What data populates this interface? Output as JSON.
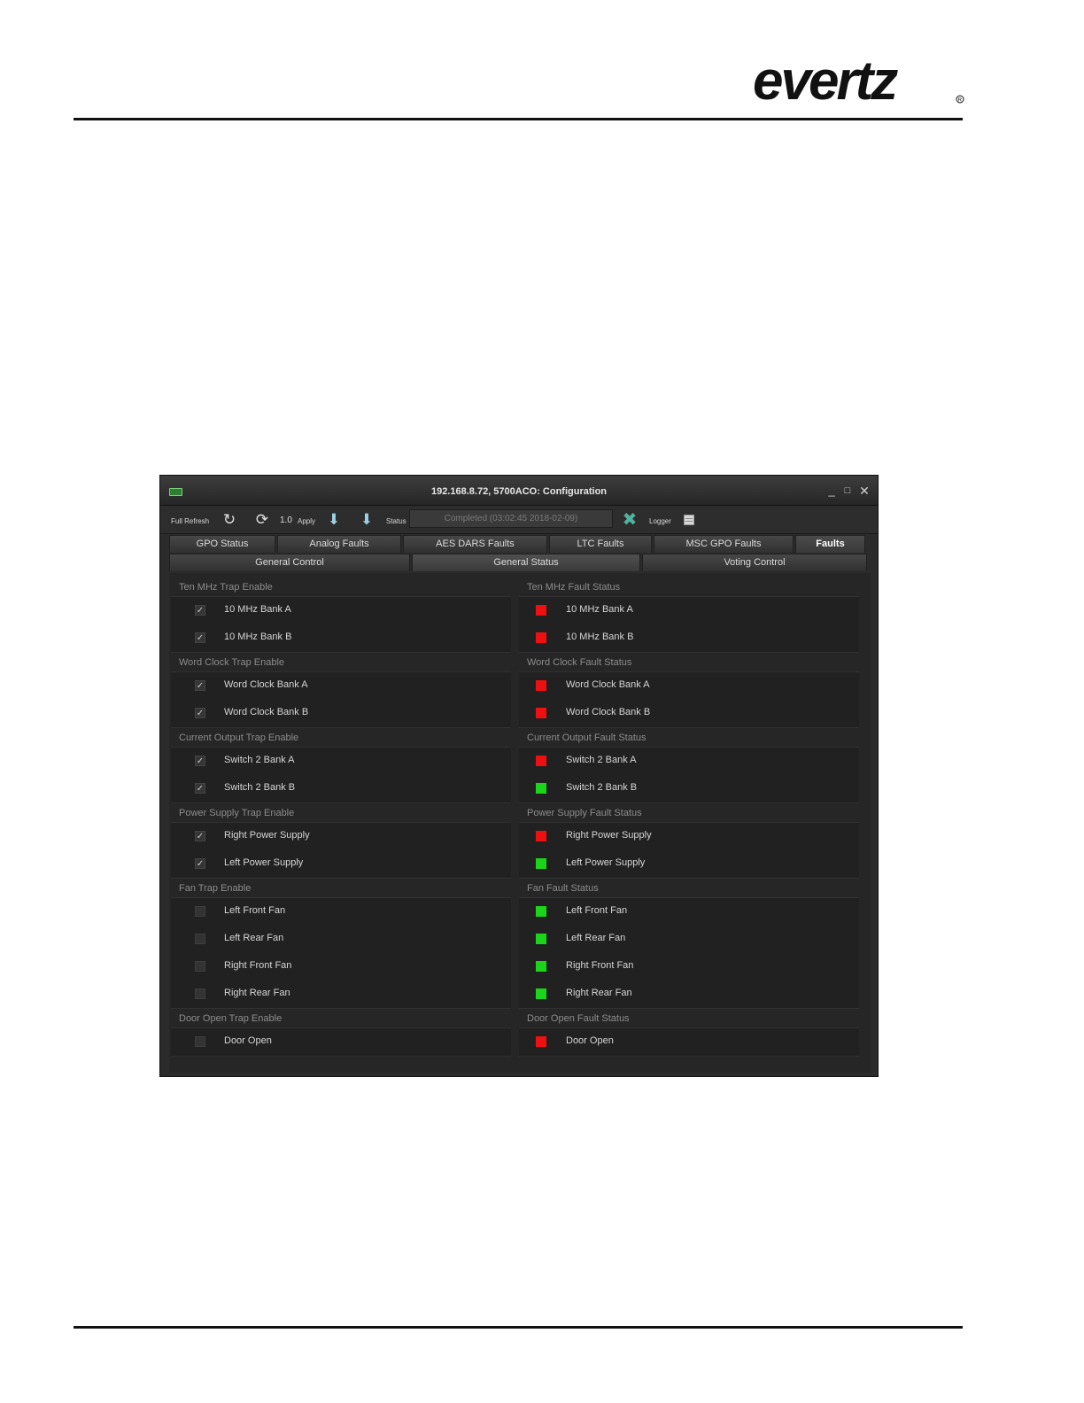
{
  "page": {
    "logo_text": "evertz"
  },
  "window": {
    "title": "192.168.8.72, 5700ACO: Configuration",
    "controls": {
      "minimize": "_",
      "maximize": "□",
      "close": "✕"
    }
  },
  "toolbar": {
    "full_refresh_label": "Full Refresh",
    "version": "1.0",
    "apply_label": "Apply",
    "status_label": "Status",
    "status_value": "Completed  (03:02:45 2018-02-09)",
    "logger_label": "Logger"
  },
  "tabs_main": [
    "GPO Status",
    "Analog Faults",
    "AES DARS Faults",
    "LTC Faults",
    "MSC GPO Faults",
    "Faults"
  ],
  "tabs_sub": [
    "General Control",
    "General Status",
    "Voting Control"
  ],
  "colors": {
    "led_red": "#ee1010",
    "led_green": "#1bd51b",
    "window_bg": "#2b2b2b"
  },
  "trap_groups": [
    {
      "title": "Ten MHz Trap Enable",
      "items": [
        {
          "label": "10 MHz Bank A",
          "checked": true
        },
        {
          "label": "10 MHz Bank B",
          "checked": true
        }
      ]
    },
    {
      "title": "Word Clock Trap Enable",
      "items": [
        {
          "label": "Word Clock Bank A",
          "checked": true
        },
        {
          "label": "Word Clock Bank B",
          "checked": true
        }
      ]
    },
    {
      "title": "Current Output Trap Enable",
      "items": [
        {
          "label": "Switch 2 Bank A",
          "checked": true
        },
        {
          "label": "Switch 2 Bank B",
          "checked": true
        }
      ]
    },
    {
      "title": "Power Supply Trap Enable",
      "items": [
        {
          "label": "Right Power Supply",
          "checked": true
        },
        {
          "label": "Left Power Supply",
          "checked": true
        }
      ]
    },
    {
      "title": "Fan Trap Enable",
      "items": [
        {
          "label": "Left Front Fan",
          "checked": false
        },
        {
          "label": "Left Rear Fan",
          "checked": false
        },
        {
          "label": "Right Front Fan",
          "checked": false
        },
        {
          "label": "Right Rear Fan",
          "checked": false
        }
      ]
    },
    {
      "title": "Door Open Trap Enable",
      "items": [
        {
          "label": "Door Open",
          "checked": false
        }
      ]
    }
  ],
  "status_groups": [
    {
      "title": "Ten MHz Fault Status",
      "items": [
        {
          "label": "10 MHz Bank A",
          "state": "red"
        },
        {
          "label": "10 MHz Bank B",
          "state": "red"
        }
      ]
    },
    {
      "title": "Word Clock Fault Status",
      "items": [
        {
          "label": "Word Clock Bank A",
          "state": "red"
        },
        {
          "label": "Word Clock Bank B",
          "state": "red"
        }
      ]
    },
    {
      "title": "Current Output Fault Status",
      "items": [
        {
          "label": "Switch 2 Bank A",
          "state": "red"
        },
        {
          "label": "Switch 2 Bank B",
          "state": "green"
        }
      ]
    },
    {
      "title": "Power Supply Fault Status",
      "items": [
        {
          "label": "Right Power Supply",
          "state": "red"
        },
        {
          "label": "Left Power Supply",
          "state": "green"
        }
      ]
    },
    {
      "title": "Fan Fault Status",
      "items": [
        {
          "label": "Left Front Fan",
          "state": "green"
        },
        {
          "label": "Left Rear Fan",
          "state": "green"
        },
        {
          "label": "Right Front Fan",
          "state": "green"
        },
        {
          "label": "Right Rear Fan",
          "state": "green"
        }
      ]
    },
    {
      "title": "Door Open Fault Status",
      "items": [
        {
          "label": "Door Open",
          "state": "red"
        }
      ]
    }
  ]
}
